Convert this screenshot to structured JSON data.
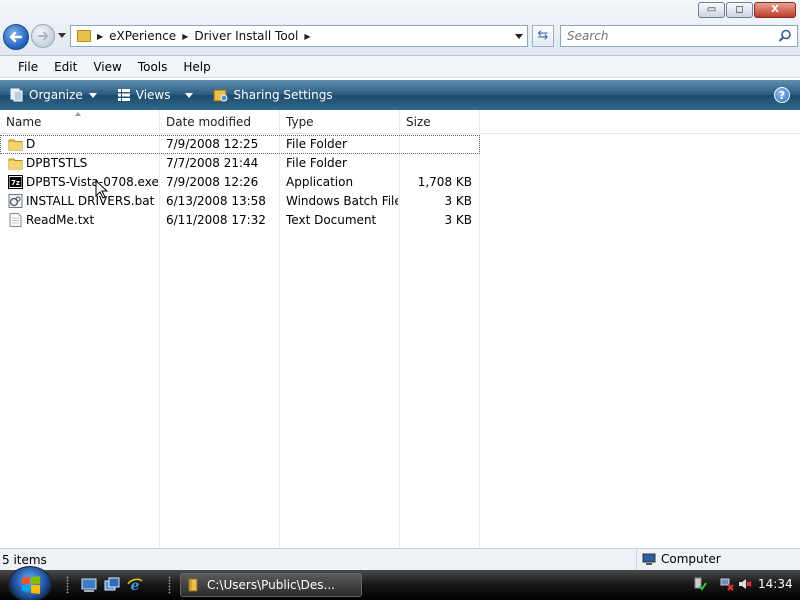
{
  "window": {
    "breadcrumbs": [
      "eXPerience",
      "Driver Install Tool"
    ],
    "search_placeholder": "Search",
    "buttons": {
      "minimize": "▭",
      "maximize": "◻",
      "close": "X"
    }
  },
  "menu": {
    "file": "File",
    "edit": "Edit",
    "view": "View",
    "tools": "Tools",
    "help": "Help"
  },
  "commands": {
    "organize": "Organize",
    "views": "Views",
    "sharing": "Sharing Settings",
    "help": "?"
  },
  "columns": {
    "name": "Name",
    "date": "Date modified",
    "type": "Type",
    "size": "Size"
  },
  "files": [
    {
      "name": "D",
      "date": "7/9/2008 12:25",
      "type": "File Folder",
      "size": "",
      "icon": "folder-icon"
    },
    {
      "name": "DPBTSTLS",
      "date": "7/7/2008 21:44",
      "type": "File Folder",
      "size": "",
      "icon": "folder-icon"
    },
    {
      "name": "DPBTS-Vista-0708.exe",
      "date": "7/9/2008 12:26",
      "type": "Application",
      "size": "1,708 KB",
      "icon": "7zip-exe-icon"
    },
    {
      "name": "INSTALL DRIVERS.bat",
      "date": "6/13/2008 13:58",
      "type": "Windows Batch File",
      "size": "3 KB",
      "icon": "batch-file-icon"
    },
    {
      "name": "ReadMe.txt",
      "date": "6/11/2008 17:32",
      "type": "Text Document",
      "size": "3 KB",
      "icon": "text-document-icon"
    }
  ],
  "status": {
    "item_count": "5 items",
    "location": "Computer"
  },
  "taskbar": {
    "window_button": "C:\\Users\\Public\\Des...",
    "clock": "14:34"
  },
  "colors": {
    "command_bar": "#2a5b7f",
    "folder": "#e8c04a",
    "taskbar": "#1a1a1a"
  }
}
